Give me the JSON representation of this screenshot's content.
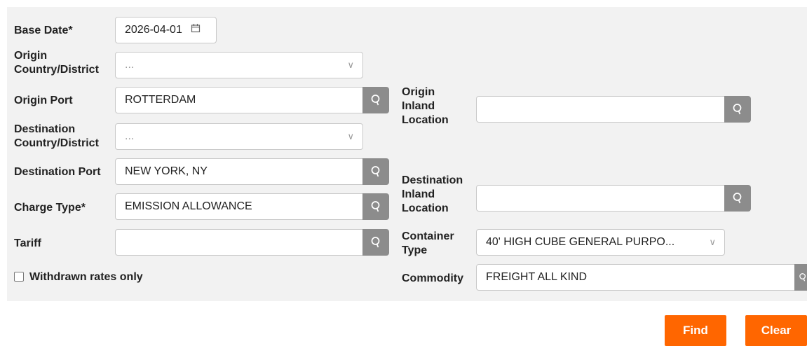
{
  "form": {
    "base_date": {
      "label": "Base Date*",
      "value": "2026-04-01"
    },
    "origin_country": {
      "label_line1": "Origin",
      "label_line2": "Country/District",
      "value": "..."
    },
    "origin_port": {
      "label": "Origin Port",
      "value": "ROTTERDAM"
    },
    "destination_country": {
      "label_line1": "Destination",
      "label_line2": "Country/District",
      "value": "..."
    },
    "destination_port": {
      "label": "Destination Port",
      "value": "NEW YORK, NY"
    },
    "charge_type": {
      "label": "Charge Type*",
      "value": "EMISSION ALLOWANCE"
    },
    "tariff": {
      "label": "Tariff",
      "value": ""
    },
    "withdrawn_rates": {
      "label": "Withdrawn rates only",
      "checked": false
    },
    "origin_inland": {
      "label_line1": "Origin",
      "label_line2": "Inland",
      "label_line3": "Location",
      "value": ""
    },
    "destination_inland": {
      "label_line1": "Destination",
      "label_line2": "Inland",
      "label_line3": "Location",
      "value": ""
    },
    "container_type": {
      "label_line1": "Container",
      "label_line2": "Type",
      "value": "40' HIGH CUBE GENERAL PURPO..."
    },
    "commodity": {
      "label": "Commodity",
      "value": "FREIGHT ALL KIND"
    }
  },
  "actions": {
    "find_label": "Find",
    "clear_label": "Clear"
  },
  "icons": {
    "search": "search-icon",
    "calendar": "calendar-icon",
    "dropdown": "chevron-down-icon",
    "checkbox": "checkbox-icon"
  },
  "colors": {
    "accent": "#ff6600",
    "panel_bg": "#f2f2f2",
    "search_button": "#8c8c8c"
  }
}
